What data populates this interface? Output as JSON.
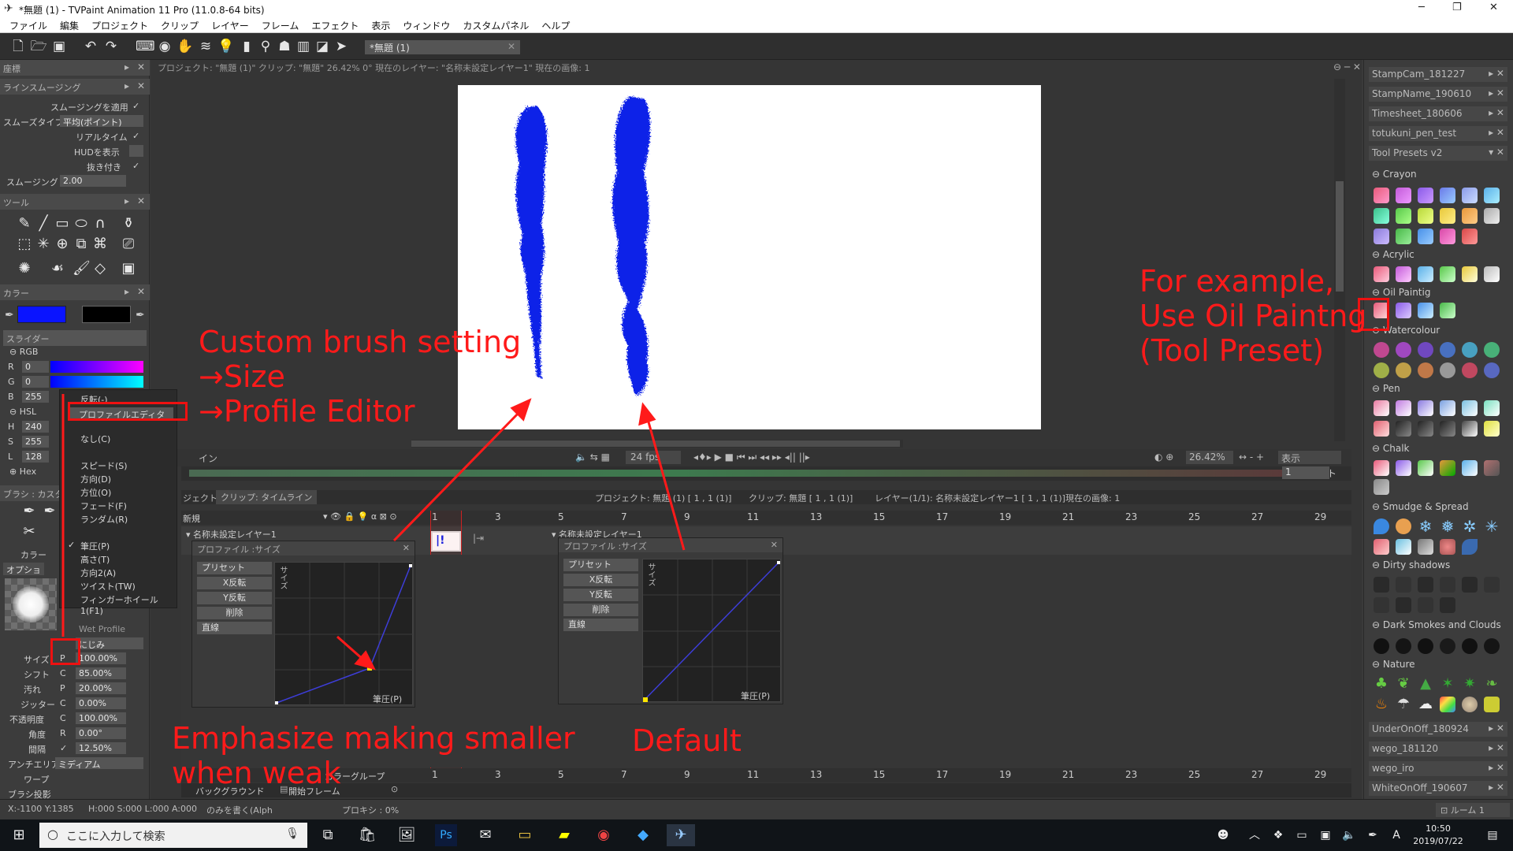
{
  "window": {
    "title": "*無題 (1) - TVPaint Animation 11 Pro (11.0.8-64 bits)",
    "min": "─",
    "max": "❐",
    "close": "✕"
  },
  "menu": [
    "ファイル",
    "編集",
    "プロジェクト",
    "クリップ",
    "レイヤー",
    "フレーム",
    "エフェクト",
    "表示",
    "ウィンドウ",
    "カスタムパネル",
    "ヘルプ"
  ],
  "toolbar": {
    "doc_tab": "*無題 (1)"
  },
  "left": {
    "coord": "座標",
    "smoothing": {
      "title": "ラインスムージング",
      "apply": "スムージングを適用",
      "type_label": "スムーズタイプ",
      "type_value": "平均(ポイント)",
      "realtime": "リアルタイム",
      "hud": "HUDを表示",
      "taper": "抜き付き",
      "smoothing_label": "スムージング",
      "smoothing_value": "2.00"
    },
    "tools": "ツール",
    "color": "カラー",
    "slider": "スライダー",
    "rgb": "RGB",
    "r": "R",
    "rv": "0",
    "g": "G",
    "gv": "0",
    "b": "B",
    "bv": "255",
    "hsl": "HSL",
    "h": "H",
    "hv": "240",
    "s": "S",
    "sv": "255",
    "l": "L",
    "lv": "128",
    "hex": "Hex",
    "brush": "ブラシ : カスタ",
    "color_tab": "カラー",
    "option_tab": "オプション",
    "wet_profile": "Wet Profile",
    "bleed": "にじみ",
    "params": [
      {
        "label": "サイズ",
        "mode": "P",
        "value": "100.00%"
      },
      {
        "label": "シフト",
        "mode": "C",
        "value": "85.00%"
      },
      {
        "label": "汚れ",
        "mode": "P",
        "value": "20.00%"
      },
      {
        "label": "ジッター",
        "mode": "C",
        "value": "0.00%"
      },
      {
        "label": "不透明度",
        "mode": "C",
        "value": "100.00%"
      },
      {
        "label": "角度",
        "mode": "R",
        "value": "0.00°"
      },
      {
        "label": "間隔",
        "mode": "✓",
        "value": "12.50%"
      }
    ],
    "antialias_label": "アンチエリアス",
    "antialias_value": "ミディアム",
    "warp": "ワープ",
    "brush_shadow": "ブラシ投影"
  },
  "context_menu": {
    "invert": "反転(-)",
    "profile_editor": "プロファイルエディタ",
    "none": "なし(C)",
    "speed": "スピード(S)",
    "direction": "方向(D)",
    "orientation": "方位(O)",
    "fade": "フェード(F)",
    "random": "ランダム(R)",
    "pressure": "筆圧(P)",
    "height": "高さ(T)",
    "direction2": "方向2(A)",
    "twist": "ツイスト(TW)",
    "finger_wheel": "フィンガーホイール1(F1)"
  },
  "info_bar": "プロジェクト: \"無題 (1)\" クリップ: \"無題\"  26.42%  0°  現在のレイヤー: \"名称未設定レイヤー1\"  現在の画像: 1",
  "controls": {
    "in": "イン",
    "out": "アウト",
    "fps": "24 fps",
    "zoom": "26.42%",
    "display": "表示",
    "out_value": "1"
  },
  "timeline": {
    "tab1": "ジェクト",
    "tab2": "クリップ: タイムライン",
    "project_info": "プロジェクト: 無題 (1) [ 1 , 1  (1)]",
    "clip_info": "クリップ: 無題 [ 1 , 1  (1)]",
    "layer_info": "レイヤー(1/1): 名称未設定レイヤー1 [ 1 , 1  (1)]",
    "image_info": "現在の画像: 1",
    "new": "新規",
    "layer_name": "名称未設定レイヤー1",
    "frames": [
      "1",
      "3",
      "5",
      "7",
      "9",
      "11",
      "13",
      "15",
      "17",
      "19",
      "21",
      "23",
      "25",
      "27",
      "29"
    ],
    "color_group": "カラーグループ",
    "background": "バックグラウンド",
    "start_frame": "開始フレーム"
  },
  "profile": {
    "title": "プロファイル :サイズ",
    "preset": "プリセット",
    "xflip": "X反転",
    "yflip": "Y反転",
    "delete": "削除",
    "linear": "直線",
    "ylabel": "サイズ",
    "xlabel": "筆圧(P)"
  },
  "right": {
    "items_top": [
      "StampCam_181227",
      "StampName_190610",
      "Timesheet_180606",
      "totukuni_pen_test",
      "Tool Presets v2"
    ],
    "categories": [
      "Crayon",
      "Acrylic",
      "Oil Paintig",
      "Watercolour",
      "Pen",
      "Chalk",
      "Smudge & Spread",
      "Dirty shadows",
      "Dark Smokes and Clouds",
      "Nature"
    ],
    "items_bottom": [
      "UnderOnOff_180924",
      "wego_181120",
      "wego_iro",
      "WhiteOnOff_190607"
    ],
    "room": "ルーム 1"
  },
  "status": {
    "coords": "X:-1100  Y:1385",
    "hsla": "H:000  S:000  L:000  A:000",
    "mode": "のみを書く(Alph",
    "proxy": "プロキシ : 0%"
  },
  "taskbar": {
    "search": "ここに入力して検索",
    "time": "10:50",
    "date": "2019/07/22",
    "ime": "A"
  },
  "annotations": {
    "custom": [
      "Custom brush setting",
      "→Size",
      "→Profile Editor"
    ],
    "example": [
      "For example,",
      "Use Oil Paintng",
      "(Tool Preset)"
    ],
    "emphasize": [
      "Emphasize making smaller",
      "when weak"
    ],
    "default": "Default"
  },
  "colors": {
    "primary": "#0a14ff",
    "accent_red": "#ff1a1a",
    "stroke": "#1020e8"
  }
}
